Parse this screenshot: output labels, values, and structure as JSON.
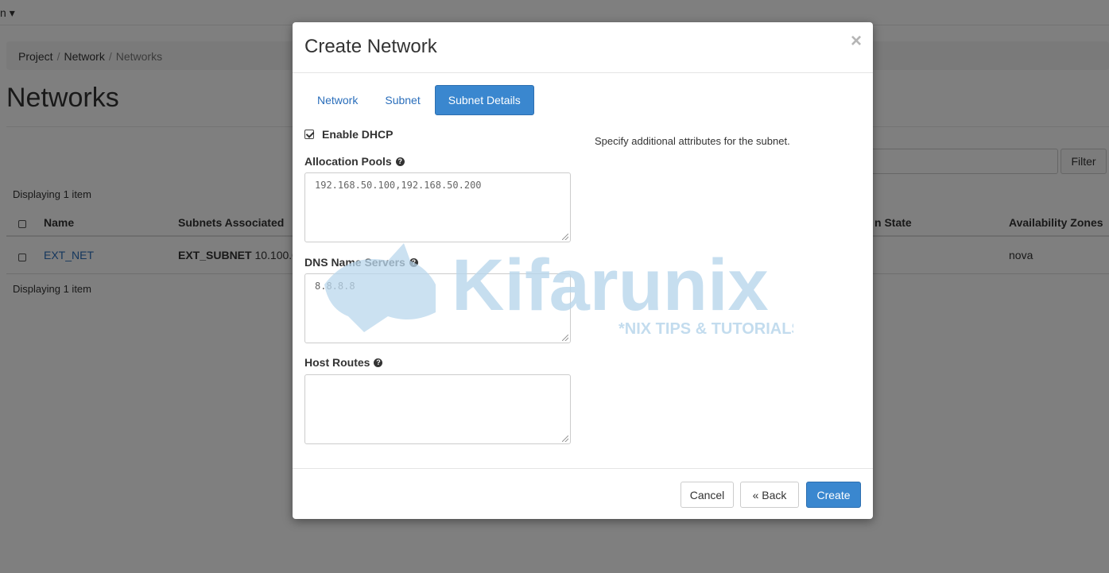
{
  "user_menu": {
    "label": "n",
    "caret": "▾"
  },
  "breadcrumb": {
    "items": [
      "Project",
      "Network"
    ],
    "current": "Networks",
    "separator": "/"
  },
  "page": {
    "title": "Networks",
    "filter_label": "Filter",
    "display_count": "Displaying 1 item"
  },
  "table": {
    "headers": {
      "name": "Name",
      "subnets": "Subnets Associated",
      "admin_state": "n State",
      "zones": "Availability Zones"
    },
    "rows": [
      {
        "name": "EXT_NET",
        "subnet_name": "EXT_SUBNET",
        "subnet_cidr": "10.100.0.",
        "zone": "nova"
      }
    ]
  },
  "modal": {
    "title": "Create Network",
    "close_glyph": "×",
    "tabs": [
      {
        "label": "Network",
        "active": false
      },
      {
        "label": "Subnet",
        "active": false
      },
      {
        "label": "Subnet Details",
        "active": true
      }
    ],
    "enable_dhcp": {
      "label": "Enable DHCP",
      "checked": true
    },
    "allocation_pools": {
      "label": "Allocation Pools",
      "value": "192.168.50.100,192.168.50.200"
    },
    "dns_name_servers": {
      "label": "DNS Name Servers",
      "value": "8.8.8.8"
    },
    "host_routes": {
      "label": "Host Routes",
      "value": ""
    },
    "help_glyph": "?",
    "help_text": "Specify additional attributes for the subnet.",
    "buttons": {
      "cancel": "Cancel",
      "back": "« Back",
      "create": "Create"
    }
  },
  "watermark": {
    "brand": "Kifarunix",
    "tagline": "*NIX TIPS & TUTORIALS"
  },
  "colors": {
    "primary": "#3a87cf",
    "link": "#2a6ebb",
    "backdrop": "rgba(0,0,0,0.5)",
    "watermark": "#b9d7ec"
  },
  "icons": {
    "checkbox": "checkbox-icon",
    "help": "question-circle-icon",
    "close": "close-icon",
    "resize": "resize-grip-icon"
  }
}
